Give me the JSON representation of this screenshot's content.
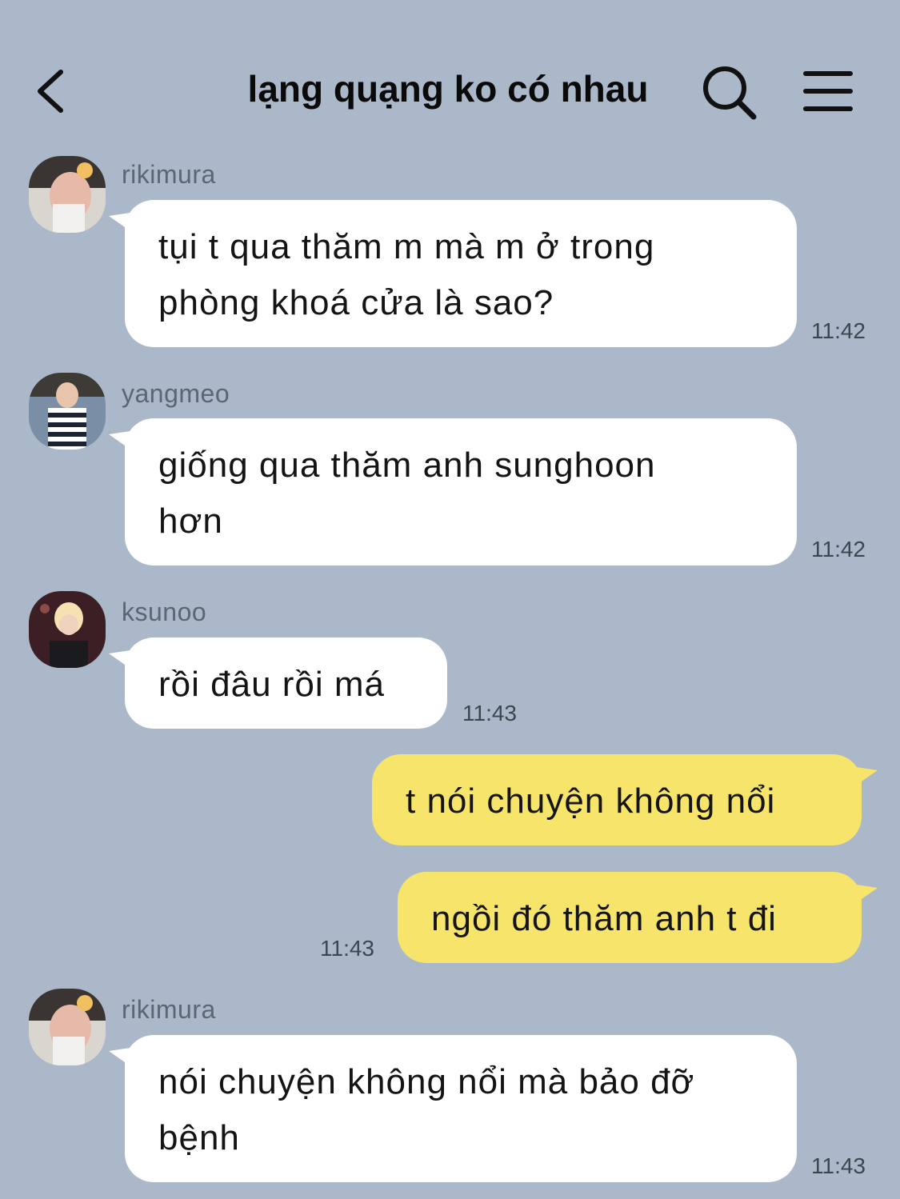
{
  "header": {
    "title": "lạng quạng ko có nhau",
    "back_icon": "chevron-left-icon",
    "search_icon": "search-icon",
    "menu_icon": "hamburger-menu-icon"
  },
  "colors": {
    "background": "#abb8c9",
    "incoming_bubble": "#ffffff",
    "outgoing_bubble": "#f7e46b"
  },
  "messages": [
    {
      "sender": "rikimura",
      "text_line1": "tụi t qua thăm m mà m ở trong",
      "text_line2": "phòng khoá cửa là sao?",
      "time": "11:42",
      "direction": "incoming"
    },
    {
      "sender": "yangmeo",
      "text_line1": "giống qua thăm anh sunghoon",
      "text_line2": "hơn",
      "time": "11:42",
      "direction": "incoming"
    },
    {
      "sender": "ksunoo",
      "text_line1": "rồi đâu rồi má",
      "time": "11:43",
      "direction": "incoming"
    },
    {
      "text_line1": "t nói chuyện không nổi",
      "direction": "outgoing"
    },
    {
      "text_line1": "ngồi đó thăm anh t đi",
      "time": "11:43",
      "direction": "outgoing"
    },
    {
      "sender": "rikimura",
      "text_line1": "nói chuyện không nổi mà bảo đỡ",
      "text_line2": "bệnh",
      "time": "11:43",
      "direction": "incoming"
    }
  ]
}
